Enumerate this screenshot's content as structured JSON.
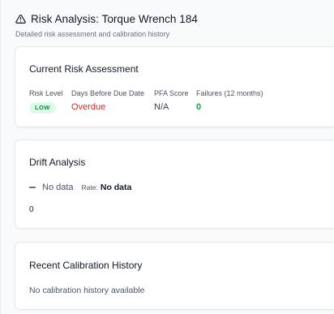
{
  "header": {
    "title": "Risk Analysis: Torque Wrench 184",
    "subtitle": "Detailed risk assessment and calibration history",
    "icon": "alert-triangle-icon"
  },
  "risk_assessment": {
    "title": "Current Risk Assessment",
    "metrics": [
      {
        "label": "Risk Level",
        "value": "LOW"
      },
      {
        "label": "Days Before Due Date",
        "value": "Overdue"
      },
      {
        "label": "PFA Score",
        "value": "N/A"
      },
      {
        "label": "Failures (12 months)",
        "value": "0"
      }
    ],
    "colors": {
      "badge_bg": "#dcfce7",
      "badge_text": "#15803d",
      "overdue": "#dc2626",
      "failures": "#16a34a"
    }
  },
  "drift": {
    "title": "Drift Analysis",
    "trend_icon": "minus-icon",
    "trend_text": "No data",
    "rate_label": "Rate:",
    "rate_value": "No data",
    "value": "0"
  },
  "history": {
    "title": "Recent Calibration History",
    "empty_text": "No calibration history available"
  }
}
